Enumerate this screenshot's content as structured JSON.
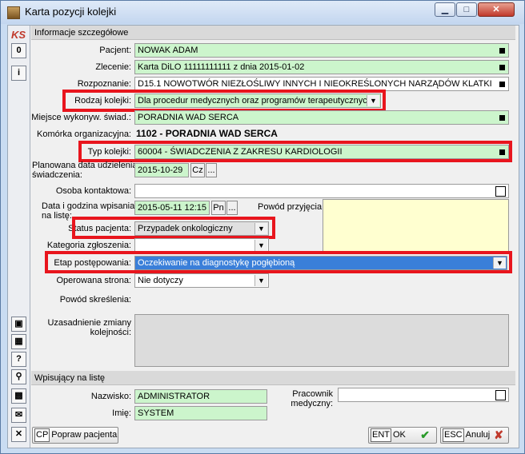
{
  "window": {
    "title": "Karta pozycji kolejki",
    "logo": "KS"
  },
  "toolbar": {
    "zero_label": "0",
    "info_label": "i",
    "question_label": "?"
  },
  "section1": {
    "title": "Informacje szczegółowe"
  },
  "fields": {
    "pacjent": {
      "label": "Pacjent:",
      "value": "NOWAK ADAM"
    },
    "zlecenie": {
      "label": "Zlecenie:",
      "value": "Karta DiLO 11111111111 z dnia 2015-01-02"
    },
    "rozpoznanie": {
      "label": "Rozpoznanie:",
      "value": "D15.1 NOWOTWÓR NIEZŁOŚLIWY INNYCH I NIEOKREŚLONYCH NARZĄDÓW KLATKI"
    },
    "rodzaj": {
      "label": "Rodzaj kolejki:",
      "value": "Dla procedur medycznych oraz programów terapeutycznych"
    },
    "miejsce": {
      "label": "Miejsce wykonyw. świad.:",
      "value": "PORADNIA WAD SERCA"
    },
    "komorka": {
      "label": "Komórka organizacyjna:",
      "value": "1102 - PORADNIA WAD SERCA"
    },
    "typ": {
      "label": "Typ kolejki:",
      "value": "60004 - ŚWIADCZENIA Z ZAKRESU KARDIOLOGII"
    },
    "planowana": {
      "label_line1": "Planowana data udzielenia",
      "label_line2": "świadczenia:",
      "value": "2015-10-29",
      "day": "Cz",
      "dots": "..."
    },
    "osoba": {
      "label": "Osoba kontaktowa:",
      "value": ""
    },
    "data_wpis": {
      "label_line1": "Data i godzina wpisania",
      "label_line2": "na listę:",
      "value": "2015-05-11 12:15",
      "day": "Pn",
      "dots": "..."
    },
    "powod_przyjecia": {
      "label": "Powód przyjęcia:",
      "value": ""
    },
    "status": {
      "label": "Status pacjenta:",
      "value": "Przypadek onkologiczny"
    },
    "kategoria": {
      "label": "Kategoria zgłoszenia:",
      "value": ""
    },
    "etap": {
      "label": "Etap postępowania:",
      "value": "Oczekiwanie na diagnostykę pogłębioną"
    },
    "strona": {
      "label": "Operowana strona:",
      "value": "Nie dotyczy"
    },
    "powod_skreslenia": {
      "label": "Powód skreślenia:"
    },
    "uzasadnienie": {
      "label_line1": "Uzasadnienie zmiany",
      "label_line2": "kolejności:",
      "value": ""
    }
  },
  "section2": {
    "title": "Wpisujący na listę"
  },
  "wpisujacy": {
    "nazwisko": {
      "label": "Nazwisko:",
      "value": "ADMINISTRATOR"
    },
    "imie": {
      "label": "Imię:",
      "value": "SYSTEM"
    },
    "pracownik": {
      "label_line1": "Pracownik",
      "label_line2": "medyczny:",
      "value": ""
    }
  },
  "buttons": {
    "popraw": {
      "key": "CP",
      "label": "Popraw pacjenta"
    },
    "ok": {
      "key": "ENT",
      "label": "OK"
    },
    "anuluj": {
      "key": "ESC",
      "label": "Anuluj"
    }
  },
  "colors": {
    "green_field": "#ccf5cc",
    "highlight_red": "#e8151d",
    "selection_blue": "#3a7fd9"
  }
}
